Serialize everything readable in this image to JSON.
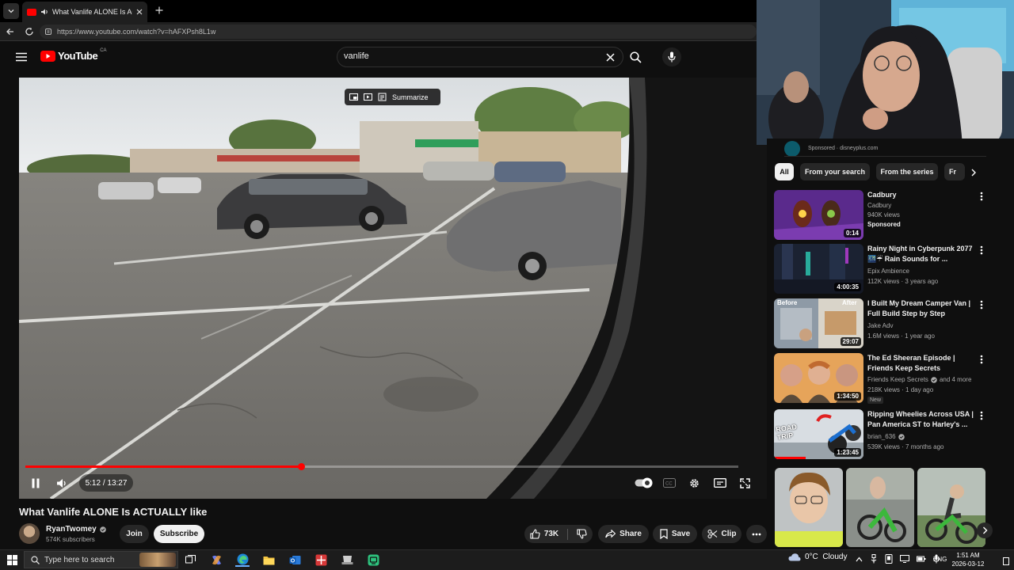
{
  "browser": {
    "tab_title": "What Vanlife ALONE Is ACTUA",
    "url": "https://www.youtube.com/watch?v=hAFXPsh8L1w"
  },
  "header": {
    "logo_text": "YouTube",
    "region": "CA",
    "search_value": "vanlife"
  },
  "player": {
    "summarize_label": "Summarize",
    "time": "5:12 / 13:27",
    "progress": 0.387
  },
  "video": {
    "title": "What Vanlife ALONE Is ACTUALLY like",
    "channel": "RyanTwomey",
    "subscribers": "574K subscribers",
    "join_label": "Join",
    "subscribe_label": "Subscribe",
    "likes": "73K",
    "share_label": "Share",
    "save_label": "Save",
    "clip_label": "Clip"
  },
  "sidebar": {
    "sponsored_partial": "Sponsored · disneyplus.com",
    "chips": [
      "All",
      "From your search",
      "From the series",
      "Fr"
    ],
    "recommendations": [
      {
        "title": "Cadbury",
        "channel": "Cadbury",
        "meta": "940K views",
        "extra": "Sponsored",
        "duration": "0:14"
      },
      {
        "title": "Rainy Night in Cyberpunk 2077 🌃☔ Rain Sounds for ...",
        "channel": "Epix Ambience",
        "meta": "112K views · 3 years ago",
        "duration": "4:00:35"
      },
      {
        "title": "I Built My Dream Camper Van | Full Build Step by Step",
        "channel": "Jake Adv",
        "meta": "1.6M views · 1 year ago",
        "duration": "29:07",
        "thumb_left": "Before",
        "thumb_right": "After"
      },
      {
        "title": "The Ed Sheeran Episode | Friends Keep Secrets",
        "channel": "Friends Keep Secrets",
        "channel_extra": "and 4 more",
        "meta": "218K views · 1 day ago",
        "badge": "New",
        "duration": "1:34:50"
      },
      {
        "title": "Ripping Wheelies Across USA | Pan America ST to Harley's ...",
        "channel": "brian_636",
        "meta": "539K views · 7 months ago",
        "duration": "1:23:45",
        "thumb_text": "ROAD TRIP"
      }
    ]
  },
  "taskbar": {
    "search_placeholder": "Type here to search",
    "weather": "0°C  Cloudy",
    "lang": "ENG",
    "time": "1:51 AM",
    "date": "2026-03-12"
  },
  "colors": {
    "accent_red": "#ff0000",
    "background": "#0f0f0f",
    "pill": "#272727"
  }
}
